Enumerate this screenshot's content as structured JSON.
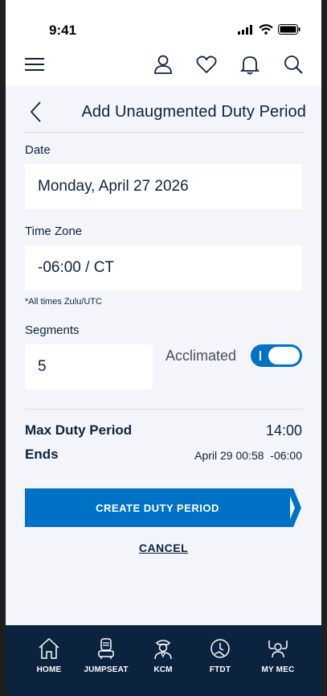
{
  "status": {
    "time": "9:41"
  },
  "header": {
    "title": "Add Unaugmented Duty Period",
    "icons": [
      "menu-icon",
      "profile-icon",
      "heart-icon",
      "bell-icon",
      "search-icon"
    ]
  },
  "form": {
    "date": {
      "label": "Date",
      "value": "Monday, April 27 2026"
    },
    "timezone": {
      "label": "Time Zone",
      "value": "-06:00 / CT"
    },
    "note": "*All times Zulu/UTC",
    "segments": {
      "label": "Segments",
      "value": "5"
    },
    "acclimated": {
      "label": "Acclimated",
      "on": true
    }
  },
  "summary": {
    "max_label": "Max Duty Period",
    "max_value": "14:00",
    "ends_label": "Ends",
    "ends_value": "April 29 00:58  -06:00"
  },
  "actions": {
    "create_label": "CREATE DUTY PERIOD",
    "cancel_label": "CANCEL"
  },
  "tabs": [
    {
      "label": "HOME",
      "icon": "home-icon"
    },
    {
      "label": "JUMPSEAT",
      "icon": "jumpseat-icon"
    },
    {
      "label": "KCM",
      "icon": "pilot-icon"
    },
    {
      "label": "FTDT",
      "icon": "clock-plane-icon"
    },
    {
      "label": "MY MEC",
      "icon": "mec-icon"
    }
  ],
  "colors": {
    "primary": "#0072c6",
    "navy": "#0c2340",
    "background": "#f4f5fa"
  }
}
